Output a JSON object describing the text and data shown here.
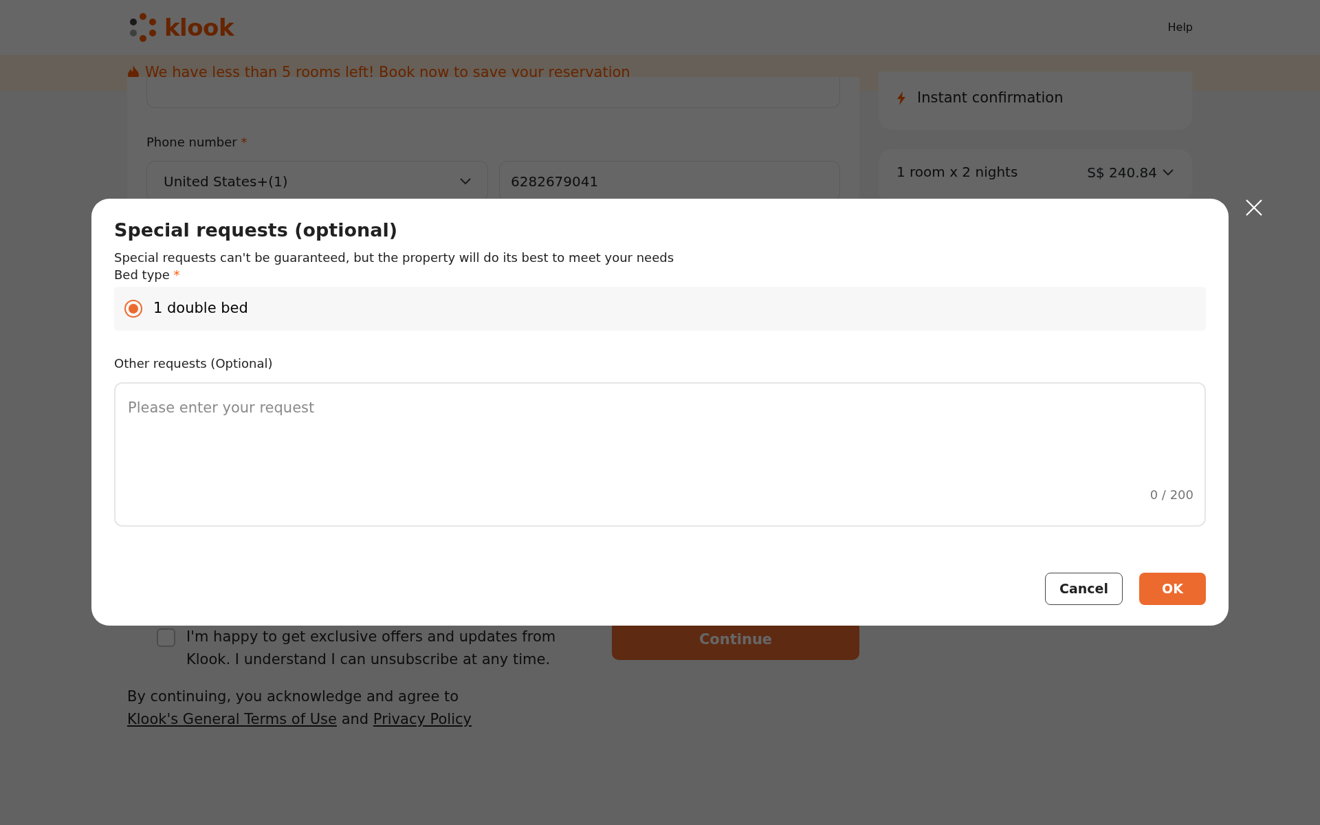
{
  "header": {
    "logo_text": "klook",
    "help": "Help"
  },
  "banner": {
    "text": "We have less than 5 rooms left! Book now to save your reservation"
  },
  "contact_form": {
    "phone_label": "Phone number",
    "required_mark": "*",
    "country_code": "United States+(1)",
    "phone_value": "6282679041"
  },
  "sidebar": {
    "feature": "Instant confirmation",
    "stay_summary": "1 room x 2 nights",
    "price": "S$ 240.84"
  },
  "modal": {
    "title": "Special requests (optional)",
    "subtitle": "Special requests can't be guaranteed, but the property will do its best to meet your needs",
    "bed_type_label": "Bed type",
    "required_mark": "*",
    "bed_options": [
      {
        "label": "1 double bed",
        "selected": true
      }
    ],
    "other_label": "Other requests (Optional)",
    "request_placeholder": "Please enter your request",
    "counter": "0 / 200",
    "buttons": [
      {
        "label": "Cancel",
        "kind": "secondary"
      },
      {
        "label": "OK",
        "kind": "primary"
      }
    ]
  },
  "footer": {
    "offers": {
      "label": "I'm happy to get exclusive offers and updates from Klook. I understand I can unsubscribe at any time.",
      "checked": false
    },
    "continue": "Continue",
    "terms": [
      {
        "kind": "text",
        "text": "By continuing, you acknowledge and agree to"
      },
      {
        "kind": "link",
        "text": "Klook's General Terms of Use"
      },
      {
        "kind": "text",
        "text": "and"
      },
      {
        "kind": "link",
        "text": "Privacy Policy"
      }
    ]
  }
}
